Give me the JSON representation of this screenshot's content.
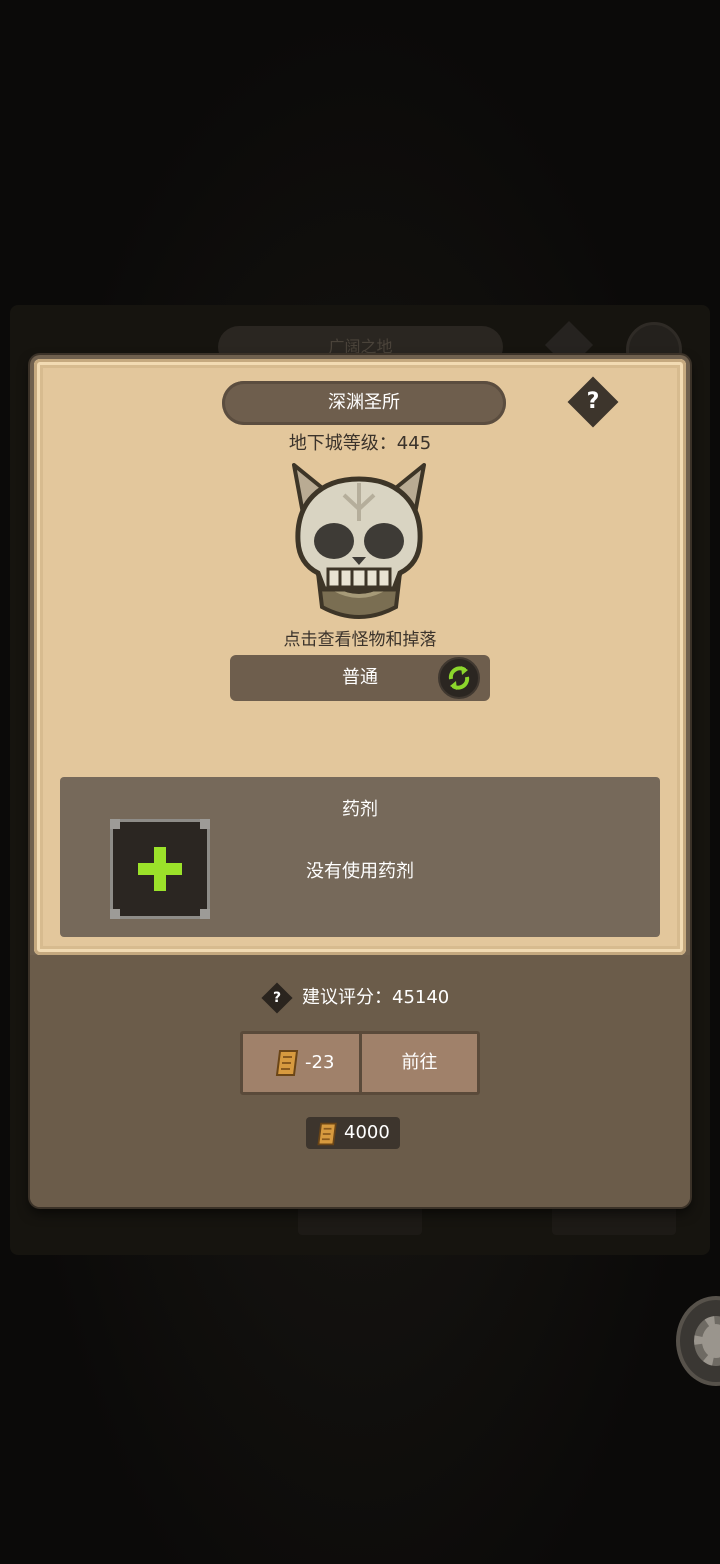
{
  "background": {
    "pill_text": "广阔之地"
  },
  "dialog": {
    "title": "深渊圣所",
    "help_symbol": "?",
    "dungeon_level": "地下城等级：445",
    "hint": "点击查看怪物和掉落",
    "mode": "普通",
    "potion": {
      "title": "药剂",
      "empty_text": "没有使用药剂"
    },
    "recommended_score": "建议评分：45140",
    "score_help_symbol": "?",
    "cost": "-23",
    "go_label": "前往",
    "balance": "4000"
  },
  "icons": {
    "boss": "horned-skull-icon",
    "mode_switch": "swap-arrows-icon",
    "add_potion": "plus-icon",
    "ticket": "scroll-ticket-icon",
    "settings": "gear-icon"
  },
  "colors": {
    "parchment": "#e3c79c",
    "panel_brown": "#6e5e4d",
    "plus_green": "#9be22a"
  }
}
